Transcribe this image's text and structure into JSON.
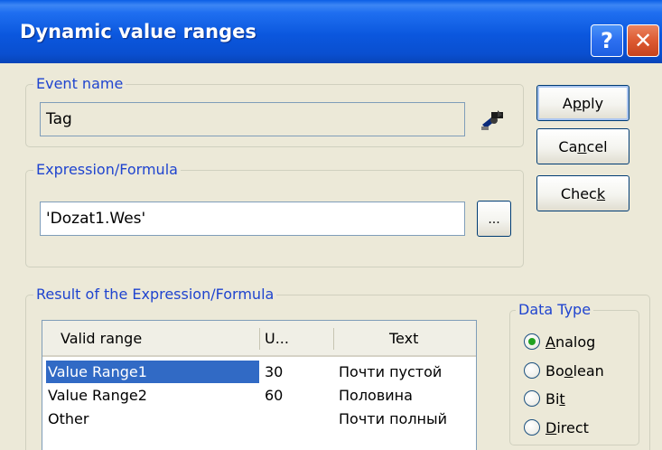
{
  "window": {
    "title": "Dynamic value ranges",
    "help_glyph": "?",
    "close_glyph": "✕"
  },
  "event_name": {
    "legend": "Event name",
    "value": "Tag"
  },
  "expression": {
    "legend": "Expression/Formula",
    "value": "'Dozat1.Wes'",
    "browse_label": "..."
  },
  "buttons": {
    "apply": {
      "pre": "A",
      "mnemonic": "p",
      "post": "ply"
    },
    "cancel": {
      "pre": "Ca",
      "mnemonic": "n",
      "post": "cel"
    },
    "check": {
      "pre": "Chec",
      "mnemonic": "k",
      "post": ""
    }
  },
  "result": {
    "legend": "Result of the Expression/Formula",
    "columns": [
      "Valid range",
      "U...",
      "Text"
    ],
    "rows": [
      {
        "range": "Value Range1",
        "value": "30",
        "text": "Почти пустой",
        "selected": true
      },
      {
        "range": "Value Range2",
        "value": "60",
        "text": "Половина",
        "selected": false
      },
      {
        "range": "Other",
        "value": "",
        "text": "Почти полный",
        "selected": false
      }
    ]
  },
  "data_type": {
    "legend": "Data Type",
    "options": [
      {
        "pre": "",
        "mnemonic": "A",
        "post": "nalog",
        "checked": true
      },
      {
        "pre": "Bo",
        "mnemonic": "o",
        "post": "lean",
        "checked": false
      },
      {
        "pre": "Bi",
        "mnemonic": "t",
        "post": "",
        "checked": false
      },
      {
        "pre": "",
        "mnemonic": "D",
        "post": "irect",
        "checked": false
      }
    ]
  },
  "icons": {
    "tag_icon": "tag-selection-icon"
  }
}
